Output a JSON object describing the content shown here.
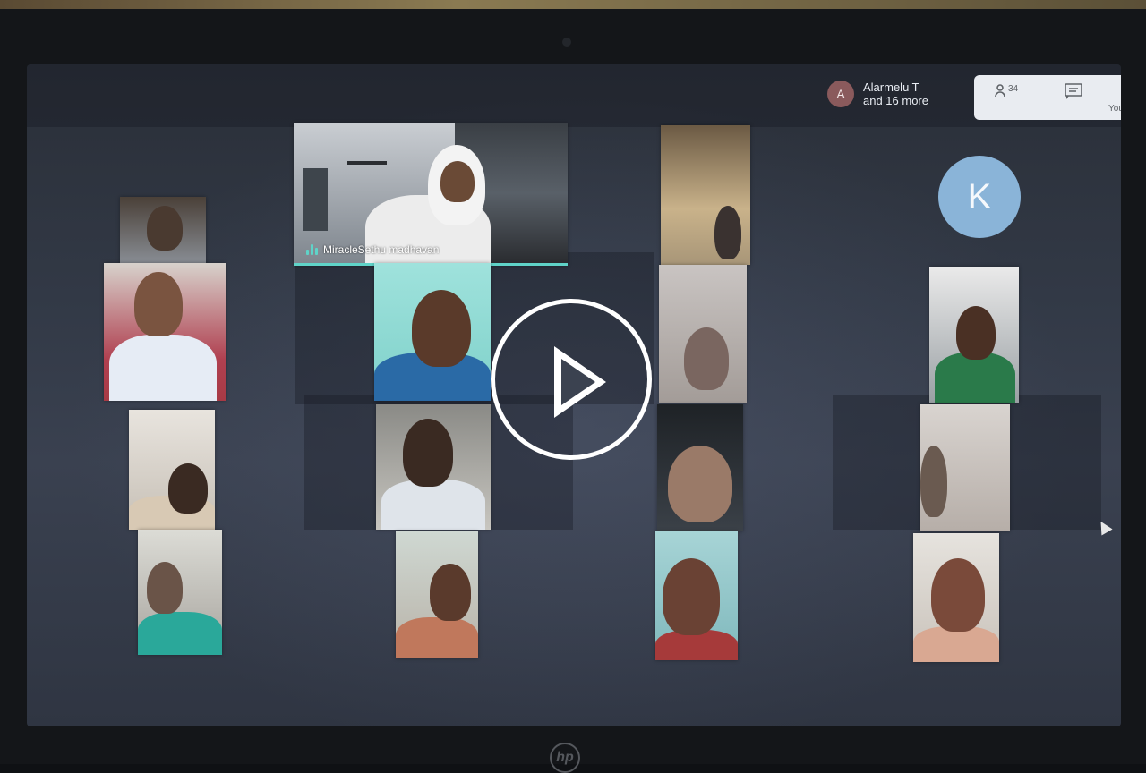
{
  "meeting": {
    "presenter_chip": {
      "avatar_letter": "A",
      "line1": "Alarmelu T",
      "line2": "and 16 more"
    },
    "controls": {
      "people_icon": "people-icon",
      "people_count": "34",
      "chat_icon": "chat-icon",
      "you_label": "You"
    },
    "main_speaker": {
      "name": "MiracleSethu madhavan"
    },
    "k_avatar_letter": "K",
    "play_icon": "play-icon"
  },
  "device": {
    "logo_text": "hp"
  },
  "colors": {
    "accent": "#5fd3c8",
    "avatar_k": "#8ab4d8",
    "avatar_a": "#8a5a5c",
    "screen_bg": "#343b48"
  }
}
